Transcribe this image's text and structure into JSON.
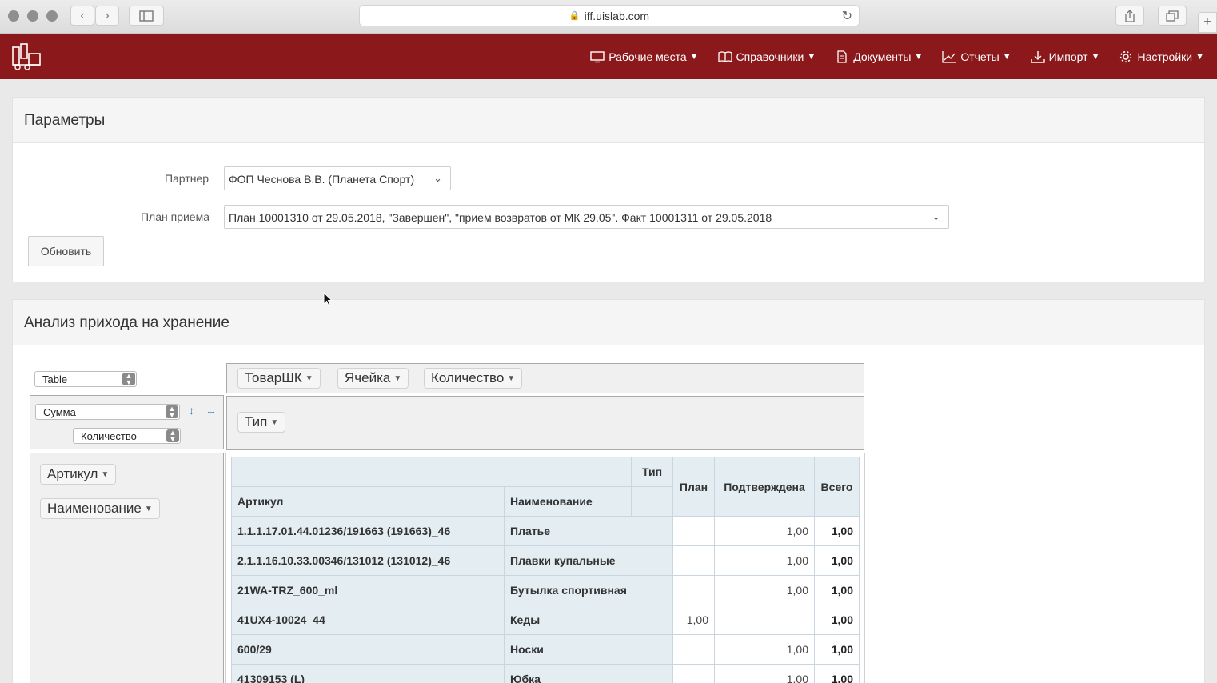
{
  "browser": {
    "url": "iff.uislab.com"
  },
  "nav": [
    {
      "label": "Рабочие места",
      "icon": "monitor-icon"
    },
    {
      "label": "Справочники",
      "icon": "book-icon"
    },
    {
      "label": "Документы",
      "icon": "document-icon"
    },
    {
      "label": "Отчеты",
      "icon": "chart-icon"
    },
    {
      "label": "Импорт",
      "icon": "download-icon"
    },
    {
      "label": "Настройки",
      "icon": "gear-icon"
    }
  ],
  "params": {
    "title": "Параметры",
    "partner_label": "Партнер",
    "partner_value": "ФОП Чеснова В.В. (Планета Спорт)",
    "plan_label": "План приема",
    "plan_value": "План 10001310 от 29.05.2018, \"Завершен\", \"прием возвратов от МК 29.05\". Факт 10001311 от 29.05.2018",
    "refresh_label": "Обновить"
  },
  "analysis": {
    "title": "Анализ прихода на хранение",
    "renderer": "Table",
    "aggregator": "Сумма",
    "aggregator_field": "Количество",
    "col_fields": [
      "ТоварШК",
      "Ячейка",
      "Количество"
    ],
    "col_attr": "Тип",
    "row_attrs": [
      "Артикул",
      "Наименование"
    ]
  },
  "table": {
    "type_label": "Тип",
    "headers": {
      "article": "Артикул",
      "name": "Наименование",
      "plan": "План",
      "confirmed": "Подтверждена",
      "total": "Всего"
    },
    "rows": [
      {
        "article": "1.1.1.17.01.44.01236/191663 (191663)_46",
        "name": "Платье",
        "plan": "",
        "confirmed": "1,00",
        "total": "1,00"
      },
      {
        "article": "2.1.1.16.10.33.00346/131012 (131012)_46",
        "name": "Плавки купальные",
        "plan": "",
        "confirmed": "1,00",
        "total": "1,00"
      },
      {
        "article": "21WA-TRZ_600_ml",
        "name": "Бутылка спортивная",
        "plan": "",
        "confirmed": "1,00",
        "total": "1,00"
      },
      {
        "article": "41UX4-10024_44",
        "name": "Кеды",
        "plan": "1,00",
        "confirmed": "",
        "total": "1,00"
      },
      {
        "article": "600/29",
        "name": "Носки",
        "plan": "",
        "confirmed": "1,00",
        "total": "1,00"
      },
      {
        "article": "41309153 (L)",
        "name": "Юбка",
        "plan": "",
        "confirmed": "1,00",
        "total": "1,00"
      }
    ]
  }
}
